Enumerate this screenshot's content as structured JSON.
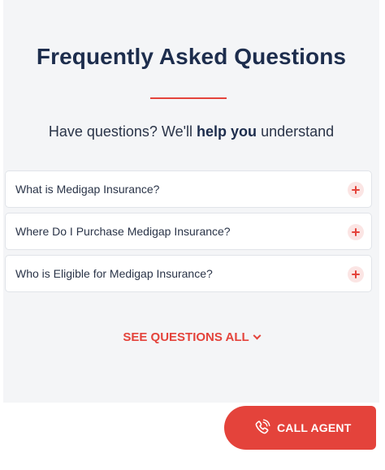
{
  "faq": {
    "title": "Frequently Asked Questions",
    "subtitle": {
      "before": "Have questions? We'll ",
      "bold": "help you",
      "after": " understand"
    },
    "items": [
      {
        "question": "What is Medigap Insurance?",
        "icon": "plus-icon"
      },
      {
        "question": "Where Do I Purchase Medigap Insurance?",
        "icon": "plus-icon"
      },
      {
        "question": "Who is Eligible for Medigap Insurance?",
        "icon": "plus-icon"
      }
    ],
    "see_all_label": "SEE QUESTIONS ALL"
  },
  "call_agent": {
    "label": "CALL AGENT",
    "icon": "phone-icon"
  },
  "colors": {
    "accent": "#e4433b",
    "title": "#1d2d4d",
    "section_bg": "#f4f5f7"
  }
}
